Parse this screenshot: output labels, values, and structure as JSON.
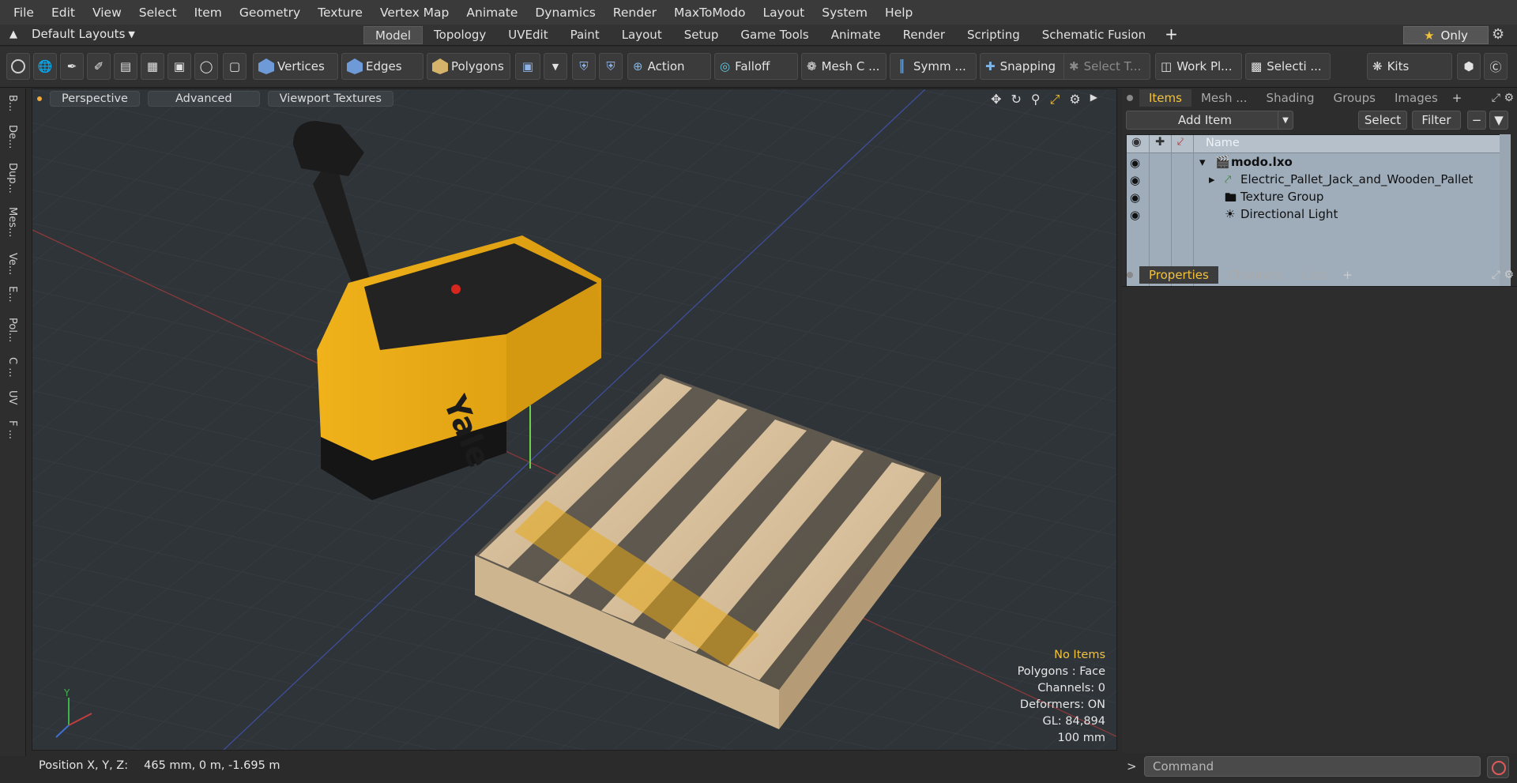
{
  "menu": [
    "File",
    "Edit",
    "View",
    "Select",
    "Item",
    "Geometry",
    "Texture",
    "Vertex Map",
    "Animate",
    "Dynamics",
    "Render",
    "MaxToModo",
    "Layout",
    "System",
    "Help"
  ],
  "layout_selector": "Default Layouts",
  "layout_tabs": [
    {
      "label": "Model",
      "active": true
    },
    {
      "label": "Topology"
    },
    {
      "label": "UVEdit"
    },
    {
      "label": "Paint"
    },
    {
      "label": "Layout"
    },
    {
      "label": "Setup"
    },
    {
      "label": "Game Tools"
    },
    {
      "label": "Animate"
    },
    {
      "label": "Render"
    },
    {
      "label": "Scripting"
    },
    {
      "label": "Schematic Fusion"
    }
  ],
  "only_label": "Only",
  "toolbar": {
    "vertices": "Vertices",
    "edges": "Edges",
    "polygons": "Polygons",
    "action": "Action",
    "falloff": "Falloff",
    "mesh": "Mesh C ...",
    "symmetry": "Symm ...",
    "snapping": "Snapping",
    "select_t": "Select T...",
    "work_plane": "Work Pl...",
    "selection": "Selecti ...",
    "kits": "Kits"
  },
  "left_strip": [
    "B...",
    "De...",
    "Dup...",
    "Mes...",
    "Ve...",
    "E...",
    "Pol...",
    "C ...",
    "UV",
    "F ..."
  ],
  "viewport": {
    "perspective": "Perspective",
    "advanced": "Advanced",
    "textures": "Viewport Textures",
    "stats": [
      "No Items",
      "Polygons : Face",
      "Channels: 0",
      "Deformers: ON",
      "GL: 84,894",
      "100 mm"
    ],
    "brand_text": "Yale",
    "axis_y": "Y"
  },
  "status": {
    "label": "Position X, Y, Z:",
    "value": "465 mm, 0 m, -1.695 m"
  },
  "items_panel": {
    "tabs": [
      {
        "label": "Items",
        "active": true
      },
      {
        "label": "Mesh ..."
      },
      {
        "label": "Shading"
      },
      {
        "label": "Groups"
      },
      {
        "label": "Images"
      }
    ],
    "add_item": "Add Item",
    "select": "Select",
    "filter": "Filter",
    "name_col": "Name",
    "rows": [
      {
        "label": "modo.lxo",
        "bold": true
      },
      {
        "label": "Electric_Pallet_Jack_and_Wooden_Pallet"
      },
      {
        "label": "Texture Group"
      },
      {
        "label": "Directional Light"
      }
    ]
  },
  "props_panel": {
    "tabs": [
      {
        "label": "Properties",
        "active": true
      },
      {
        "label": "Channels"
      },
      {
        "label": "Lists"
      }
    ]
  },
  "command_placeholder": "Command",
  "colors": {
    "accent": "#f3c23b",
    "tree_bg": "#9fadbb",
    "viewport_bg": "#2f3439"
  }
}
